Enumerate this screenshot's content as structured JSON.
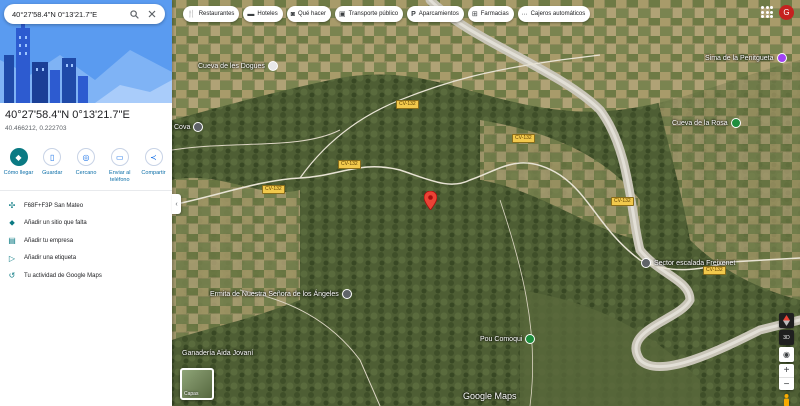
{
  "search": {
    "query": "40°27'58.4\"N 0°13'21.7\"E"
  },
  "place": {
    "title": "40°27'58.4\"N 0°13'21.7\"E",
    "decimal": "40.466212, 0.222703"
  },
  "actions": [
    {
      "label": "Cómo llegar",
      "icon": "directions-icon"
    },
    {
      "label": "Guardar",
      "icon": "bookmark-icon"
    },
    {
      "label": "Cercano",
      "icon": "nearby-icon"
    },
    {
      "label": "Enviar al teléfono",
      "icon": "phone-icon"
    },
    {
      "label": "Compartir",
      "icon": "share-icon"
    }
  ],
  "details": [
    {
      "label": "F68F+F3P San Mateo",
      "icon": "plus-code-icon"
    },
    {
      "label": "Añadir un sitio que falta",
      "icon": "add-place-icon"
    },
    {
      "label": "Añadir tu empresa",
      "icon": "business-icon"
    },
    {
      "label": "Añadir una etiqueta",
      "icon": "label-icon"
    },
    {
      "label": "Tu actividad de Google Maps",
      "icon": "history-icon"
    }
  ],
  "chips": [
    {
      "label": "Restaurantes",
      "icon": "restaurant-icon"
    },
    {
      "label": "Hoteles",
      "icon": "hotel-icon"
    },
    {
      "label": "Qué hacer",
      "icon": "camera-icon"
    },
    {
      "label": "Transporte público",
      "icon": "transit-icon"
    },
    {
      "label": "Aparcamientos",
      "icon": "parking-icon"
    },
    {
      "label": "Farmacias",
      "icon": "pharmacy-icon"
    },
    {
      "label": "Cajeros automáticos",
      "icon": "atm-icon"
    }
  ],
  "account": {
    "initial": "G"
  },
  "map_labels": {
    "places": [
      "Cueva de les Dogues",
      "Sima de la Penitgueta",
      "Cueva de la Rosa",
      "Sector escalada Freixenet",
      "Ermita de Nuestra Señora de los Ángeles",
      "Pou Comoqui",
      "Ganadería Aida Jovaní"
    ],
    "roads": [
      "CV-132",
      "CV-132",
      "CV-132",
      "CV-132",
      "CV-132",
      "CV-132"
    ],
    "view_3d": "3D",
    "layers_label": "Capas",
    "logo": "Google Maps",
    "edge_label": "Cova"
  },
  "colors": {
    "accent": "#0b7a83",
    "pin": "#ea4335",
    "road_label": "#f2c94c"
  }
}
